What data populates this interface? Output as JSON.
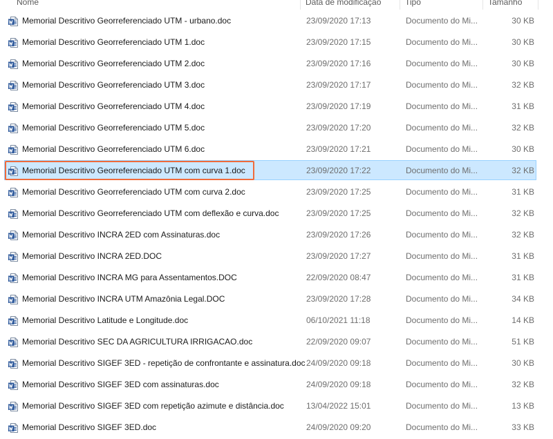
{
  "columns": {
    "name": "Nome",
    "date": "Data de modificação",
    "type": "Tipo",
    "size": "Tamanho"
  },
  "icon": "word-document-icon",
  "selected_index": 7,
  "colors": {
    "selected_bg": "#cce8ff",
    "selected_border": "#99d1ff",
    "highlight_outline": "#f06b3b",
    "word_blue": "#2b579a"
  },
  "files": [
    {
      "name": "Memorial Descritivo Georreferenciado UTM - urbano.doc",
      "date": "23/09/2020 17:13",
      "type": "Documento do Mi...",
      "size": "30 KB"
    },
    {
      "name": "Memorial Descritivo Georreferenciado UTM 1.doc",
      "date": "23/09/2020 17:15",
      "type": "Documento do Mi...",
      "size": "30 KB"
    },
    {
      "name": "Memorial Descritivo Georreferenciado UTM 2.doc",
      "date": "23/09/2020 17:16",
      "type": "Documento do Mi...",
      "size": "30 KB"
    },
    {
      "name": "Memorial Descritivo Georreferenciado UTM 3.doc",
      "date": "23/09/2020 17:17",
      "type": "Documento do Mi...",
      "size": "32 KB"
    },
    {
      "name": "Memorial Descritivo Georreferenciado UTM 4.doc",
      "date": "23/09/2020 17:19",
      "type": "Documento do Mi...",
      "size": "31 KB"
    },
    {
      "name": "Memorial Descritivo Georreferenciado UTM 5.doc",
      "date": "23/09/2020 17:20",
      "type": "Documento do Mi...",
      "size": "32 KB"
    },
    {
      "name": "Memorial Descritivo Georreferenciado UTM 6.doc",
      "date": "23/09/2020 17:21",
      "type": "Documento do Mi...",
      "size": "30 KB"
    },
    {
      "name": "Memorial Descritivo Georreferenciado UTM com curva 1.doc",
      "date": "23/09/2020 17:22",
      "type": "Documento do Mi...",
      "size": "32 KB"
    },
    {
      "name": "Memorial Descritivo Georreferenciado UTM com curva 2.doc",
      "date": "23/09/2020 17:25",
      "type": "Documento do Mi...",
      "size": "31 KB"
    },
    {
      "name": "Memorial Descritivo Georreferenciado UTM com deflexão e curva.doc",
      "date": "23/09/2020 17:25",
      "type": "Documento do Mi...",
      "size": "32 KB"
    },
    {
      "name": "Memorial Descritivo INCRA 2ED com Assinaturas.doc",
      "date": "23/09/2020 17:26",
      "type": "Documento do Mi...",
      "size": "32 KB"
    },
    {
      "name": "Memorial Descritivo INCRA 2ED.DOC",
      "date": "23/09/2020 17:27",
      "type": "Documento do Mi...",
      "size": "31 KB"
    },
    {
      "name": "Memorial Descritivo INCRA MG para Assentamentos.DOC",
      "date": "22/09/2020 08:47",
      "type": "Documento do Mi...",
      "size": "31 KB"
    },
    {
      "name": "Memorial Descritivo INCRA UTM Amazônia Legal.DOC",
      "date": "23/09/2020 17:28",
      "type": "Documento do Mi...",
      "size": "34 KB"
    },
    {
      "name": "Memorial Descritivo Latitude e Longitude.doc",
      "date": "06/10/2021 11:18",
      "type": "Documento do Mi...",
      "size": "14 KB"
    },
    {
      "name": "Memorial Descritivo SEC DA AGRICULTURA IRRIGACAO.doc",
      "date": "22/09/2020 09:07",
      "type": "Documento do Mi...",
      "size": "51 KB"
    },
    {
      "name": "Memorial Descritivo SIGEF 3ED - repetição de confrontante e assinatura.doc",
      "date": "24/09/2020 09:18",
      "type": "Documento do Mi...",
      "size": "30 KB"
    },
    {
      "name": "Memorial Descritivo SIGEF 3ED com assinaturas.doc",
      "date": "24/09/2020 09:18",
      "type": "Documento do Mi...",
      "size": "32 KB"
    },
    {
      "name": "Memorial Descritivo SIGEF 3ED com repetição azimute e distância.doc",
      "date": "13/04/2022 15:01",
      "type": "Documento do Mi...",
      "size": "13 KB"
    },
    {
      "name": "Memorial Descritivo SIGEF 3ED.doc",
      "date": "24/09/2020 09:20",
      "type": "Documento do Mi...",
      "size": "33 KB"
    }
  ]
}
